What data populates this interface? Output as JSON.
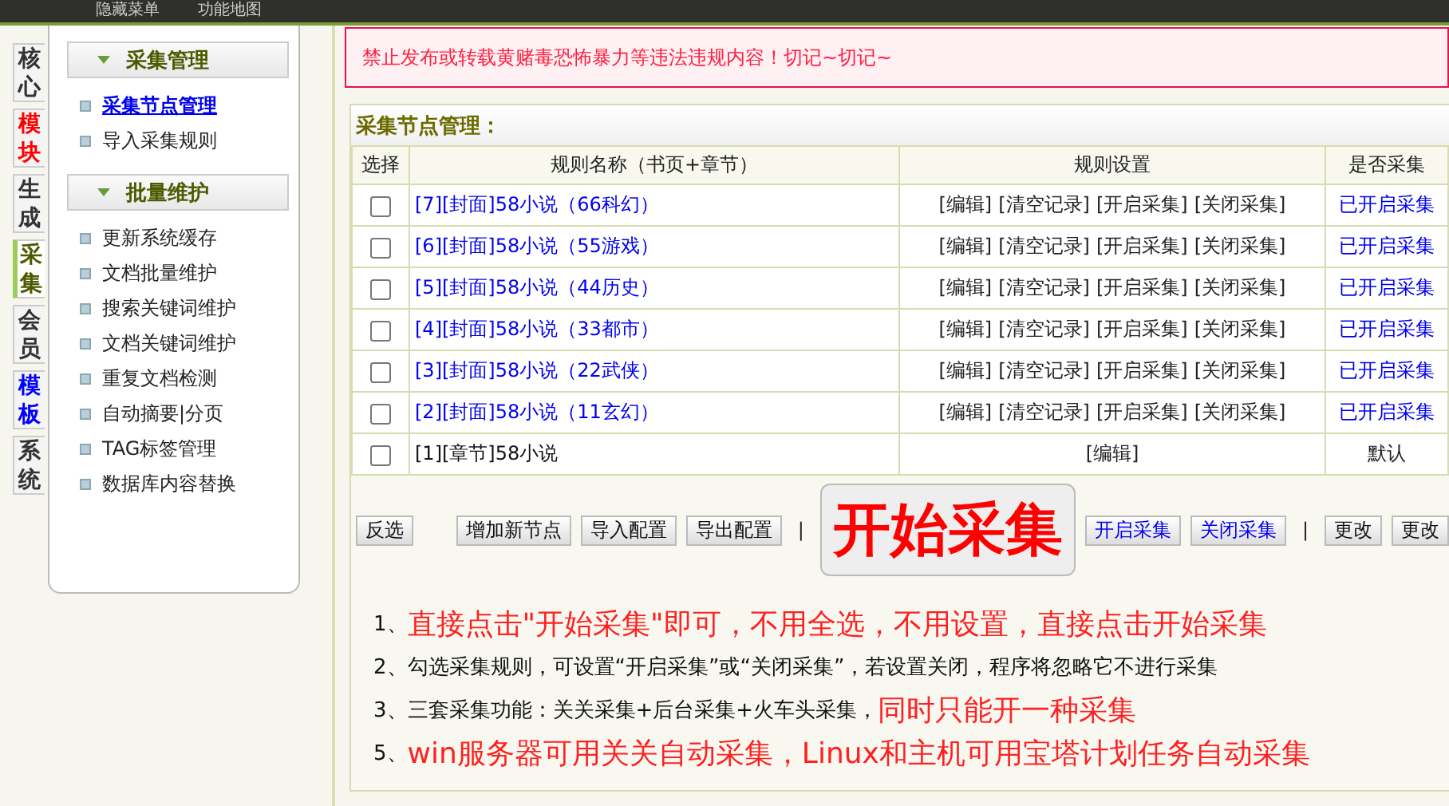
{
  "top_bar": {
    "items": [
      "隐藏菜单",
      "功能地图"
    ]
  },
  "side_tabs": [
    {
      "label": "核心",
      "selected": false,
      "color": "#333333"
    },
    {
      "label": "模块",
      "selected": false,
      "color": "#ff0000"
    },
    {
      "label": "生成",
      "selected": false,
      "color": "#333333"
    },
    {
      "label": "采集",
      "selected": true,
      "color": "#4d5a00"
    },
    {
      "label": "会员",
      "selected": false,
      "color": "#333333"
    },
    {
      "label": "模板",
      "selected": false,
      "color": "#0000ff"
    },
    {
      "label": "系统",
      "selected": false,
      "color": "#333333"
    }
  ],
  "side_menu": [
    {
      "title": "采集管理",
      "items": [
        {
          "label": "采集节点管理",
          "selected": true
        },
        {
          "label": "导入采集规则",
          "selected": false
        }
      ]
    },
    {
      "title": "批量维护",
      "items": [
        {
          "label": "更新系统缓存",
          "selected": false
        },
        {
          "label": "文档批量维护",
          "selected": false
        },
        {
          "label": "搜索关键词维护",
          "selected": false
        },
        {
          "label": "文档关键词维护",
          "selected": false
        },
        {
          "label": "重复文档检测",
          "selected": false
        },
        {
          "label": "自动摘要|分页",
          "selected": false
        },
        {
          "label": "TAG标签管理",
          "selected": false
        },
        {
          "label": "数据库内容替换",
          "selected": false
        }
      ]
    }
  ],
  "alert": "禁止发布或转载黄赌毒恐怖暴力等违法违规内容！切记~切记~",
  "table": {
    "title": "采集节点管理：",
    "columns": [
      "选择",
      "规则名称（书页+章节）",
      "规则设置",
      "是否采集"
    ],
    "rows": [
      {
        "kind": "cover",
        "checked": false,
        "name": "[7][封面]58小说（66科幻）",
        "actions": [
          "[编辑]",
          "[清空记录]",
          "[开启采集]",
          "[关闭采集]"
        ],
        "status": "已开启采集"
      },
      {
        "kind": "cover",
        "checked": false,
        "name": "[6][封面]58小说（55游戏）",
        "actions": [
          "[编辑]",
          "[清空记录]",
          "[开启采集]",
          "[关闭采集]"
        ],
        "status": "已开启采集"
      },
      {
        "kind": "cover",
        "checked": false,
        "name": "[5][封面]58小说（44历史）",
        "actions": [
          "[编辑]",
          "[清空记录]",
          "[开启采集]",
          "[关闭采集]"
        ],
        "status": "已开启采集"
      },
      {
        "kind": "cover",
        "checked": false,
        "name": "[4][封面]58小说（33都市）",
        "actions": [
          "[编辑]",
          "[清空记录]",
          "[开启采集]",
          "[关闭采集]"
        ],
        "status": "已开启采集"
      },
      {
        "kind": "cover",
        "checked": false,
        "name": "[3][封面]58小说（22武侠）",
        "actions": [
          "[编辑]",
          "[清空记录]",
          "[开启采集]",
          "[关闭采集]"
        ],
        "status": "已开启采集"
      },
      {
        "kind": "cover",
        "checked": false,
        "name": "[2][封面]58小说（11玄幻）",
        "actions": [
          "[编辑]",
          "[清空记录]",
          "[开启采集]",
          "[关闭采集]"
        ],
        "status": "已开启采集"
      },
      {
        "kind": "chapter",
        "checked": false,
        "name": "[1][章节]58小说",
        "actions": [
          "[编辑]"
        ],
        "status": "默认"
      }
    ]
  },
  "toolbar": [
    {
      "kind": "plain",
      "label": "反选"
    },
    {
      "kind": "gap"
    },
    {
      "kind": "plain",
      "label": "增加新节点"
    },
    {
      "kind": "plain",
      "label": "导入配置"
    },
    {
      "kind": "plain",
      "label": "导出配置"
    },
    {
      "kind": "separator",
      "label": "|"
    },
    {
      "kind": "primary",
      "label": "开始采集"
    },
    {
      "kind": "link",
      "label": "开启采集"
    },
    {
      "kind": "link",
      "label": "关闭采集"
    },
    {
      "kind": "separator",
      "label": "|"
    },
    {
      "kind": "plain",
      "label": "更改"
    },
    {
      "kind": "plain",
      "label": "更改"
    }
  ],
  "instructions": [
    [
      {
        "text": "1、",
        "emphasis": false
      },
      {
        "text": "直接点击\"开始采集\"即可，不用全选，不用设置，直接点击开始采集",
        "emphasis": true
      }
    ],
    [
      {
        "text": "2、勾选采集规则，可设置“开启采集”或“关闭采集”，若设置关闭，程序将忽略它不进行采集",
        "emphasis": false
      }
    ],
    [
      {
        "text": "3、三套采集功能：关关采集+后台采集+火车头采集，",
        "emphasis": false
      },
      {
        "text": "同时只能开一种采集",
        "emphasis": true
      }
    ],
    [
      {
        "text": "5、",
        "emphasis": false
      },
      {
        "text": "win服务器可用关关自动采集，Linux和主机可用宝塔计划任务自动采集",
        "emphasis": true
      }
    ]
  ]
}
